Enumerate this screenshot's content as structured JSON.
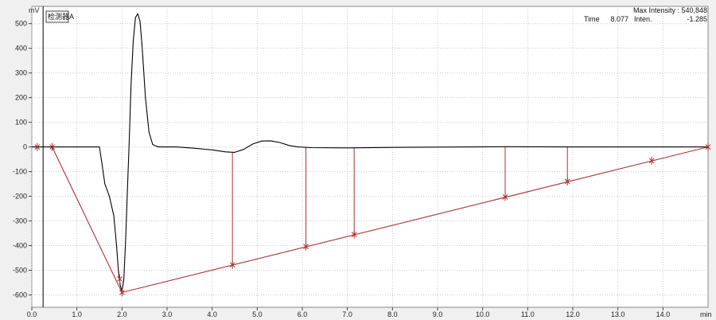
{
  "header": {
    "detector_label": "检测器A",
    "max_intensity_label": "Max Intensity : 540,848",
    "time_label": "Time",
    "time_value": "8.077",
    "inten_label": "Inten.",
    "inten_value": "-1.285"
  },
  "chart_data": {
    "type": "line",
    "ylabel": "mV",
    "xlabel": "min",
    "xlim": [
      0,
      15
    ],
    "ylim": [
      -650,
      570
    ],
    "grid": true,
    "x_ticks": [
      "0.0",
      "1.0",
      "2.0",
      "3.0",
      "4.0",
      "5.0",
      "6.0",
      "7.0",
      "8.0",
      "9.0",
      "10.0",
      "11.0",
      "12.0",
      "13.0",
      "14.0"
    ],
    "y_ticks": [
      "500",
      "400",
      "300",
      "200",
      "100",
      "0",
      "-100",
      "-200",
      "-300",
      "-400",
      "-500",
      "-600"
    ],
    "series": [
      {
        "role": "signal",
        "color": "#000000",
        "points": [
          [
            0.0,
            0
          ],
          [
            1.5,
            0
          ],
          [
            1.55,
            -60
          ],
          [
            1.62,
            -150
          ],
          [
            1.72,
            -200
          ],
          [
            1.82,
            -280
          ],
          [
            1.88,
            -400
          ],
          [
            1.92,
            -500
          ],
          [
            1.96,
            -560
          ],
          [
            2.0,
            -585
          ],
          [
            2.04,
            -540
          ],
          [
            2.08,
            -380
          ],
          [
            2.12,
            -180
          ],
          [
            2.16,
            20
          ],
          [
            2.2,
            250
          ],
          [
            2.25,
            430
          ],
          [
            2.3,
            525
          ],
          [
            2.35,
            540
          ],
          [
            2.4,
            510
          ],
          [
            2.45,
            400
          ],
          [
            2.52,
            200
          ],
          [
            2.6,
            60
          ],
          [
            2.68,
            10
          ],
          [
            2.8,
            0
          ],
          [
            3.2,
            0
          ],
          [
            3.6,
            -5
          ],
          [
            4.0,
            -12
          ],
          [
            4.3,
            -20
          ],
          [
            4.5,
            -22
          ],
          [
            4.7,
            -10
          ],
          [
            4.9,
            12
          ],
          [
            5.1,
            24
          ],
          [
            5.3,
            25
          ],
          [
            5.5,
            18
          ],
          [
            5.7,
            6
          ],
          [
            5.9,
            0
          ],
          [
            6.2,
            -3
          ],
          [
            7.0,
            -4
          ],
          [
            8.0,
            -2
          ],
          [
            10.5,
            1
          ],
          [
            12.0,
            0
          ],
          [
            15.0,
            0
          ]
        ]
      },
      {
        "role": "baseline",
        "color": "#b03030",
        "points": [
          [
            0.45,
            0
          ],
          [
            2.0,
            -590
          ],
          [
            15.0,
            0
          ]
        ]
      }
    ],
    "baseline_markers": [
      {
        "x": 0.12,
        "y": 0
      },
      {
        "x": 0.45,
        "y": 0
      },
      {
        "x": 1.95,
        "y": -535
      },
      {
        "x": 2.0,
        "y": -590
      },
      {
        "x": 4.45,
        "y": -478
      },
      {
        "x": 6.08,
        "y": -404
      },
      {
        "x": 7.15,
        "y": -355
      },
      {
        "x": 10.5,
        "y": -203
      },
      {
        "x": 11.88,
        "y": -140
      },
      {
        "x": 13.75,
        "y": -56
      },
      {
        "x": 15.0,
        "y": 0
      }
    ],
    "drop_lines": [
      {
        "x": 4.45,
        "top": -22
      },
      {
        "x": 6.08,
        "top": -2
      },
      {
        "x": 7.15,
        "top": -4
      },
      {
        "x": 10.5,
        "top": 1
      },
      {
        "x": 11.88,
        "top": 0
      }
    ],
    "cursor_x": 0.25
  }
}
